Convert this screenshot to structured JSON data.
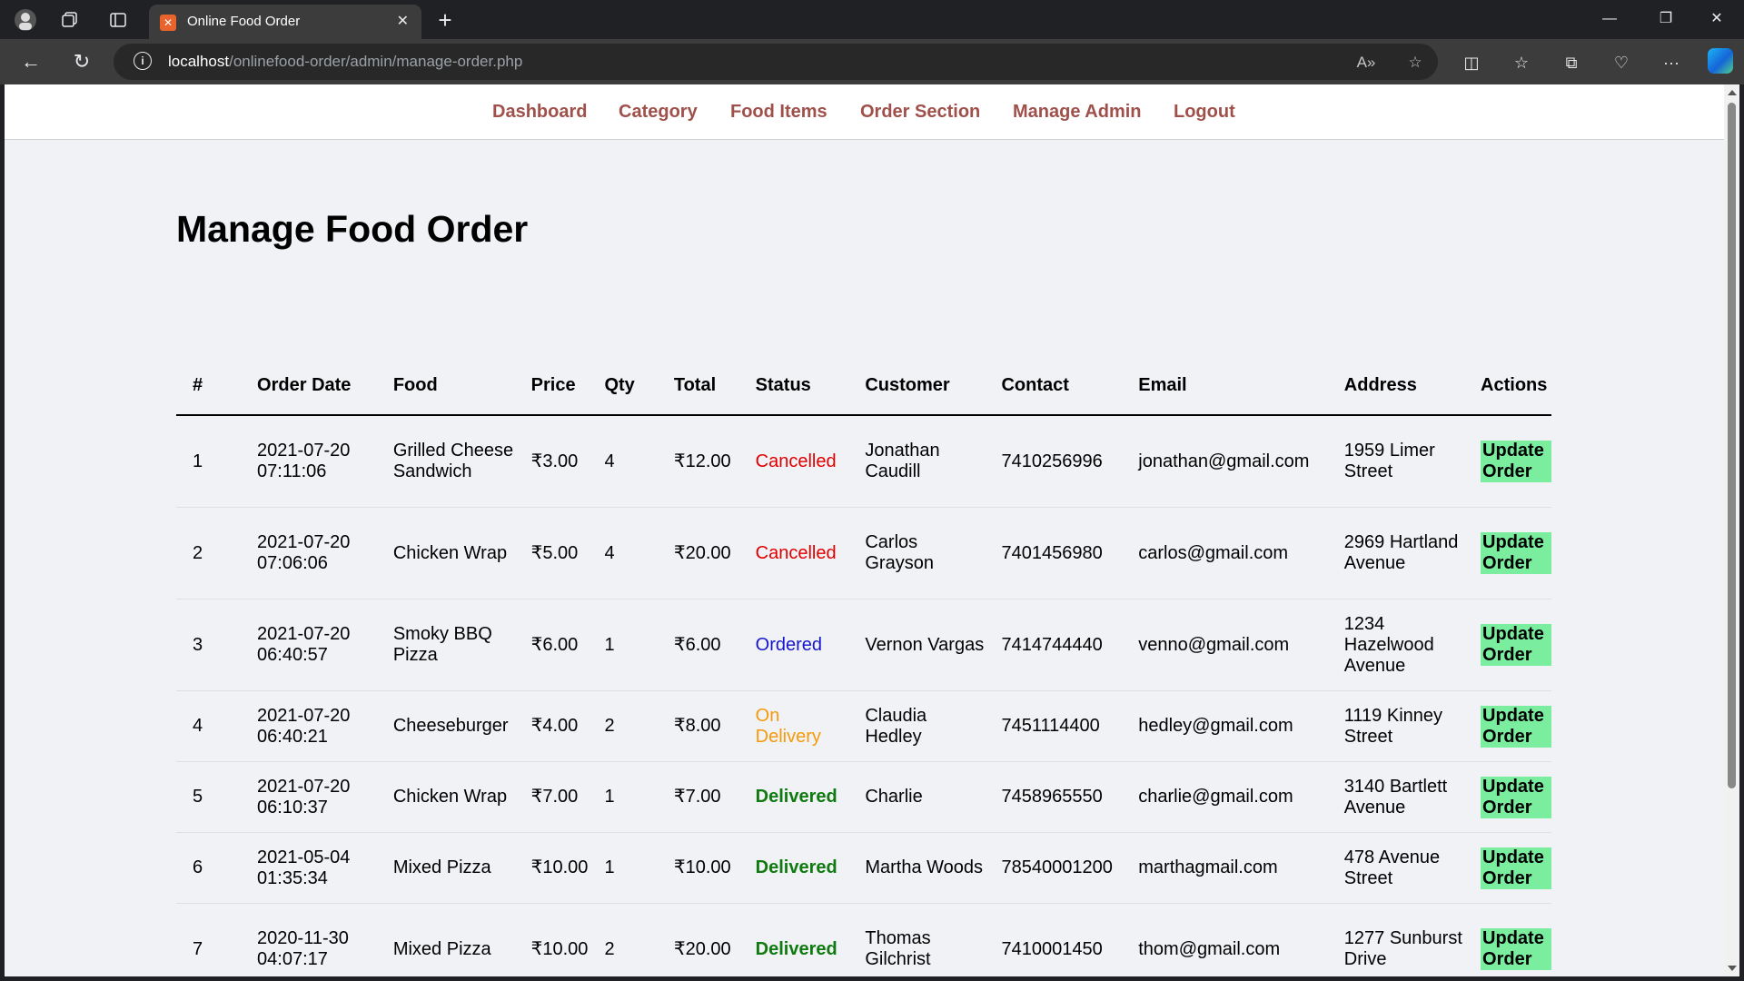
{
  "browser": {
    "tab_title": "Online Food Order",
    "url_host": "localhost",
    "url_path": "/onlinefood-order/admin/manage-order.php"
  },
  "menu": {
    "dashboard": "Dashboard",
    "category": "Category",
    "food_items": "Food Items",
    "order_section": "Order Section",
    "manage_admin": "Manage Admin",
    "logout": "Logout"
  },
  "page_title": "Manage Food Order",
  "table": {
    "headers": {
      "num": "#",
      "order_date": "Order Date",
      "food": "Food",
      "price": "Price",
      "qty": "Qty",
      "total": "Total",
      "status": "Status",
      "customer": "Customer",
      "contact": "Contact",
      "email": "Email",
      "address": "Address",
      "actions": "Actions"
    },
    "action_label": "Update Order",
    "rows": [
      {
        "num": "1",
        "date": "2021-07-20 07:11:06",
        "food": "Grilled Cheese Sandwich",
        "price": "₹3.00",
        "qty": "4",
        "total": "₹12.00",
        "status": "Cancelled",
        "customer": "Jonathan Caudill",
        "contact": "7410256996",
        "email": "jonathan@gmail.com",
        "address": "1959 Limer Street"
      },
      {
        "num": "2",
        "date": "2021-07-20 07:06:06",
        "food": "Chicken Wrap",
        "price": "₹5.00",
        "qty": "4",
        "total": "₹20.00",
        "status": "Cancelled",
        "customer": "Carlos Grayson",
        "contact": "7401456980",
        "email": "carlos@gmail.com",
        "address": "2969 Hartland Avenue"
      },
      {
        "num": "3",
        "date": "2021-07-20 06:40:57",
        "food": "Smoky BBQ Pizza",
        "price": "₹6.00",
        "qty": "1",
        "total": "₹6.00",
        "status": "Ordered",
        "customer": "Vernon Vargas",
        "contact": "7414744440",
        "email": "venno@gmail.com",
        "address": "1234 Hazelwood Avenue"
      },
      {
        "num": "4",
        "date": "2021-07-20 06:40:21",
        "food": "Cheeseburger",
        "price": "₹4.00",
        "qty": "2",
        "total": "₹8.00",
        "status": "On Delivery",
        "customer": "Claudia Hedley",
        "contact": "7451114400",
        "email": "hedley@gmail.com",
        "address": "1119 Kinney Street"
      },
      {
        "num": "5",
        "date": "2021-07-20 06:10:37",
        "food": "Chicken Wrap",
        "price": "₹7.00",
        "qty": "1",
        "total": "₹7.00",
        "status": "Delivered",
        "customer": "Charlie",
        "contact": "7458965550",
        "email": "charlie@gmail.com",
        "address": "3140 Bartlett Avenue"
      },
      {
        "num": "6",
        "date": "2021-05-04 01:35:34",
        "food": "Mixed Pizza",
        "price": "₹10.00",
        "qty": "1",
        "total": "₹10.00",
        "status": "Delivered",
        "customer": "Martha Woods",
        "contact": "78540001200",
        "email": "marthagmail.com",
        "address": "478 Avenue Street"
      },
      {
        "num": "7",
        "date": "2020-11-30 04:07:17",
        "food": "Mixed Pizza",
        "price": "₹10.00",
        "qty": "2",
        "total": "₹20.00",
        "status": "Delivered",
        "customer": "Thomas Gilchrist",
        "contact": "7410001450",
        "email": "thom@gmail.com",
        "address": "1277 Sunburst Drive"
      }
    ]
  },
  "colors": {
    "menu_link": "#a0504a",
    "status_cancelled": "#e00000",
    "status_ordered": "#1515cc",
    "status_on_delivery": "#f59a0a",
    "status_delivered": "#0f7a0f",
    "update_button_bg": "#7bed9f",
    "page_bg": "#f1f2f6"
  },
  "icons": [
    "profile-icon",
    "workspaces-icon",
    "tab-actions-icon",
    "favicon-icon",
    "close-tab-icon",
    "new-tab-icon",
    "minimize-icon",
    "restore-icon",
    "close-window-icon",
    "back-icon",
    "refresh-icon",
    "site-info-icon",
    "read-aloud-icon",
    "favorite-star-icon",
    "split-screen-icon",
    "favorites-icon",
    "collections-icon",
    "browser-essentials-icon",
    "more-icon",
    "copilot-icon"
  ]
}
